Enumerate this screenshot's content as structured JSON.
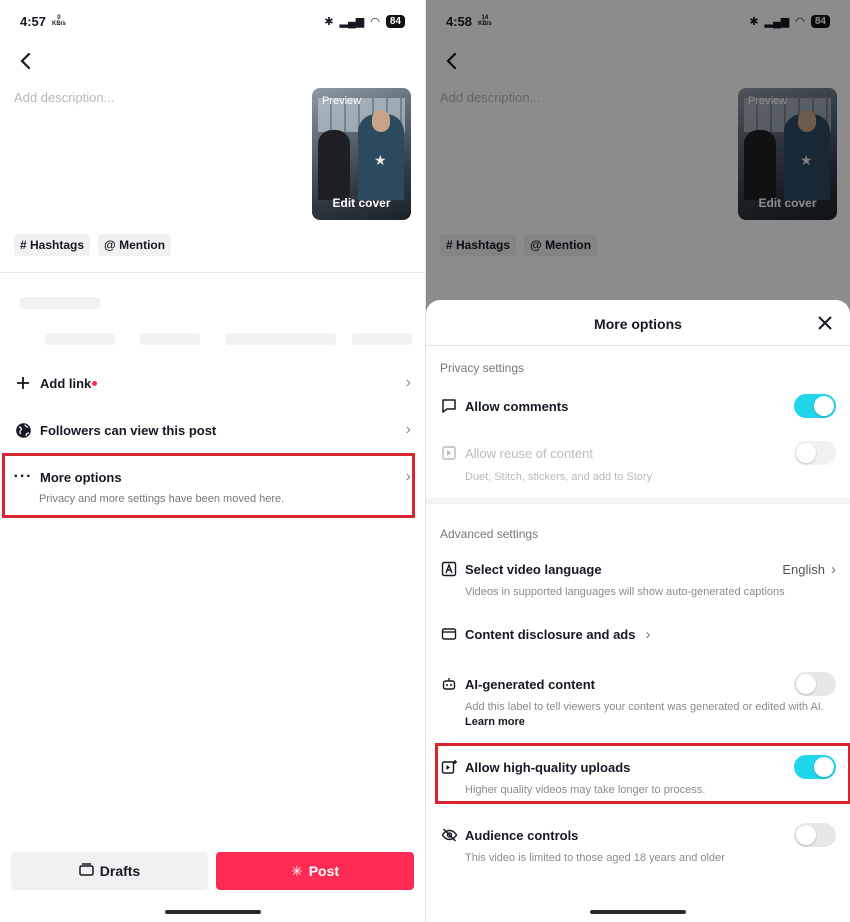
{
  "left": {
    "status": {
      "time": "4:57",
      "net_speed": "0",
      "net_unit": "KB/s",
      "battery": "84"
    },
    "description_placeholder": "Add description...",
    "cover": {
      "preview": "Preview",
      "edit_cover": "Edit cover"
    },
    "chips": {
      "hashtags": "Hashtags",
      "mention": "Mention"
    },
    "rows": {
      "add_link": "Add link",
      "followers": "Followers can view this post",
      "more_options": "More options",
      "more_options_sub": "Privacy and more settings have been moved here."
    },
    "buttons": {
      "drafts": "Drafts",
      "post": "Post"
    }
  },
  "right": {
    "status": {
      "time": "4:58",
      "net_speed": "14",
      "net_unit": "KB/s",
      "battery": "84"
    },
    "description_placeholder": "Add description...",
    "cover": {
      "preview": "Preview",
      "edit_cover": "Edit cover"
    },
    "chips": {
      "hashtags": "Hashtags",
      "mention": "Mention"
    },
    "sheet": {
      "title": "More options",
      "privacy_header": "Privacy settings",
      "allow_comments": "Allow comments",
      "allow_reuse": "Allow reuse of content",
      "allow_reuse_sub": "Duet, Stitch, stickers, and add to Story",
      "advanced_header": "Advanced settings",
      "video_language": "Select video language",
      "video_language_value": "English",
      "video_language_sub": "Videos in supported languages will show auto-generated captions",
      "disclosure": "Content disclosure and ads",
      "ai_content": "AI-generated content",
      "ai_content_sub": "Add this label to tell viewers your content was generated or edited with AI.",
      "learn_more": "Learn more",
      "hq_uploads": "Allow high-quality uploads",
      "hq_uploads_sub": "Higher quality videos may take longer to process.",
      "audience": "Audience controls",
      "audience_sub": "This video is limited to those aged 18 years and older"
    },
    "toggles": {
      "allow_comments": true,
      "allow_reuse": false,
      "ai_content": false,
      "hq_uploads": true,
      "audience": false
    }
  },
  "colors": {
    "accent_toggle": "#20d5ec",
    "post_button": "#fe2c55",
    "highlight_box": "#d6252f"
  }
}
